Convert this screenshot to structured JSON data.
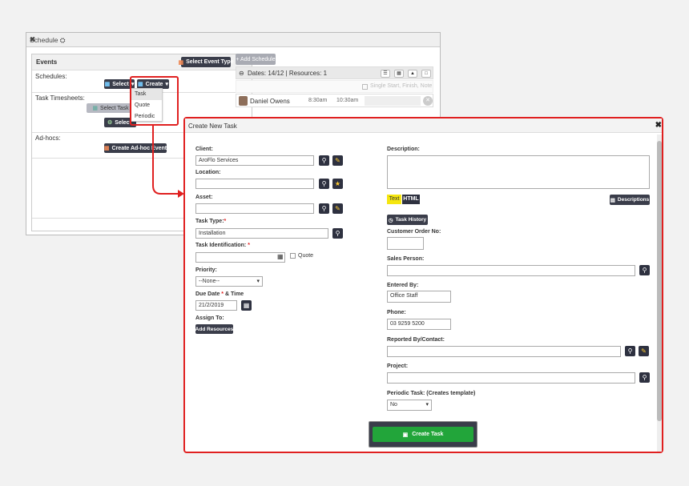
{
  "schedule_window": {
    "title": "Schedule ⛭",
    "close": "✖",
    "events_label": "Events",
    "select_event_type": "Select Event Type",
    "schedules_label": "Schedules:",
    "select_label": "Select",
    "create_label": "Create",
    "task_timesheets_label": "Task Timesheets:",
    "select_task": "Select Task",
    "select_hidden": "Select",
    "adhocs_label": "Ad-hocs:",
    "create_adhoc": "Create Ad-hoc Event",
    "dropdown_items": [
      "Task",
      "Quote",
      "Periodic"
    ],
    "add_schedule": "+ Add Schedule",
    "dates_text": "Dates: 14/12  |  Resources: 1",
    "single_start_text": "Single Start, Finish, Note",
    "resource": {
      "name": "Daniel Owens",
      "start": "8:30am",
      "end": "10:30am"
    }
  },
  "create_task": {
    "title": "Create New Task",
    "close": "✖",
    "client_label": "Client:",
    "client_value": "AroFlo Services",
    "location_label": "Location:",
    "asset_label": "Asset:",
    "task_type_label": "Task Type:",
    "task_type_value": "Installation",
    "task_id_label": "Task Identification:",
    "quote_label": "Quote",
    "priority_label": "Priority:",
    "priority_value": "--None--",
    "due_date_label_a": "Due Date",
    "due_date_label_b": "& Time",
    "due_date_value": "21/2/2019",
    "assign_to_label": "Assign To:",
    "add_resources": "Add Resources",
    "description_label": "Description:",
    "text_tab": "Text",
    "html_tab": "HTML",
    "descriptions_btn": "Descriptions",
    "task_history_btn": "Task History",
    "customer_order_label": "Customer Order No:",
    "sales_person_label": "Sales Person:",
    "entered_by_label": "Entered By:",
    "entered_by_value": "Office Staff",
    "phone_label": "Phone:",
    "phone_value": "03 9259 5200",
    "reported_by_label": "Reported By/Contact:",
    "project_label": "Project:",
    "periodic_label": "Periodic Task: (Creates template)",
    "periodic_value": "No",
    "create_task_btn": "Create Task",
    "required_mark": "*"
  },
  "colors": {
    "accent_red": "#e02020",
    "dark_button": "#3a3d4a",
    "create_green": "#22a53a",
    "text_tab_yellow": "#f5e60f"
  }
}
